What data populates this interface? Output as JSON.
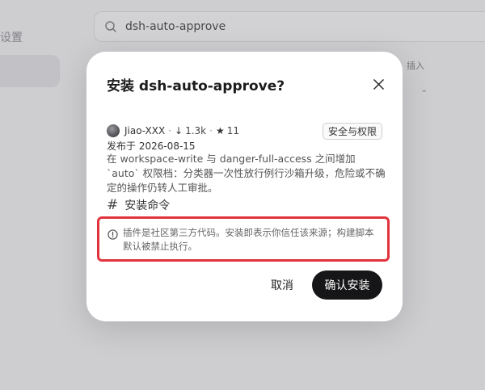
{
  "background": {
    "sidebar_label": "设置",
    "search_value": "dsh-auto-approve",
    "right_text": "插入"
  },
  "dialog": {
    "title": "安装 dsh-auto-approve?",
    "author": "Jiao-XXX",
    "downloads": "1.3k",
    "stars": "11",
    "category_badge": "安全与权限",
    "published": "发布于 2026-08-15",
    "description": "在 workspace-write 与 danger-full-access 之间增加 `auto` 权限档：分类器一次性放行例行沙箱升级，危险或不确定的操作仍转人工审批。",
    "section_heading": "安装命令",
    "warning": "插件是社区第三方代码。安装即表示你信任该来源；构建脚本默认被禁止执行。",
    "cancel_label": "取消",
    "confirm_label": "确认安装"
  },
  "colors": {
    "warning_border": "#e2333d",
    "confirm_bg": "#161618"
  },
  "icons": [
    "search-icon",
    "close-icon",
    "download-arrow-icon",
    "star-icon",
    "hash-icon",
    "alert-circle-icon"
  ]
}
